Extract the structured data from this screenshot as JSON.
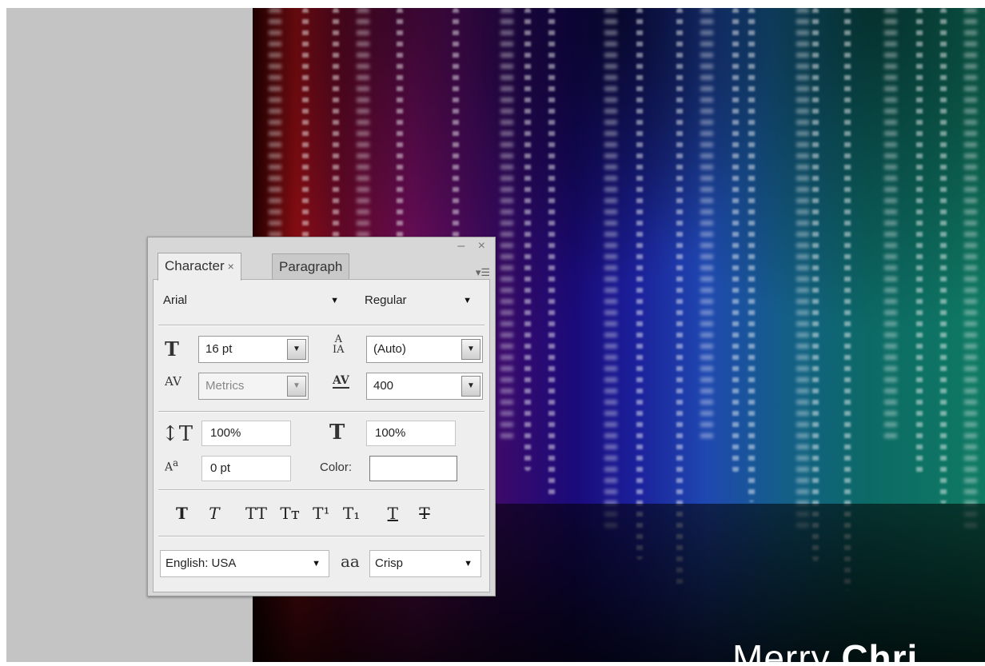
{
  "colors": {
    "workspace": "#c4c4c4",
    "panel": "#d7d7d7",
    "panel_body": "#eeeeee"
  },
  "panel": {
    "window_controls": "– ×",
    "tabs": [
      {
        "label": "Character",
        "close": "×",
        "active": true
      },
      {
        "label": "Paragraph",
        "active": false
      }
    ],
    "menu_icon": "menu-icon",
    "font_family": "Arial",
    "font_style": "Regular",
    "font_size": "16 pt",
    "leading": "(Auto)",
    "kerning": "Metrics",
    "tracking": "400",
    "vertical_scale": "100%",
    "horizontal_scale": "100%",
    "baseline_shift": "0 pt",
    "color_label": "Color:",
    "style_buttons": [
      {
        "name": "faux-bold",
        "glyph": "T"
      },
      {
        "name": "faux-italic",
        "glyph": "T"
      },
      {
        "name": "all-caps",
        "glyph": "TT"
      },
      {
        "name": "small-caps",
        "glyph": "Tт"
      },
      {
        "name": "superscript",
        "glyph": "T¹"
      },
      {
        "name": "subscript",
        "glyph": "T₁"
      },
      {
        "name": "underline",
        "glyph": "T"
      },
      {
        "name": "strikethrough",
        "glyph": "T"
      }
    ],
    "language": "English: USA",
    "antialias_icon": "aa",
    "antialias": "Crisp"
  },
  "canvas": {
    "greeting_regular": "Merry ",
    "greeting_bold": "Chri"
  }
}
